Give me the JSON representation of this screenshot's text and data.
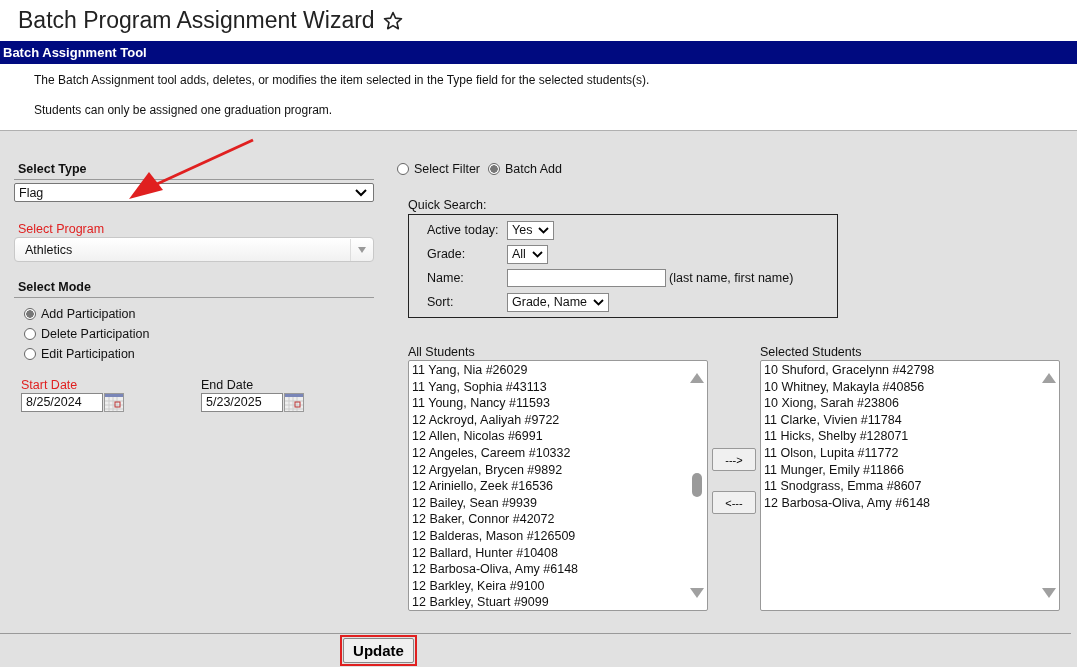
{
  "page_title": "Batch Program Assignment Wizard",
  "favorite": {
    "starred": false
  },
  "header_bar": {
    "title": "Batch Assignment Tool"
  },
  "description": [
    "The Batch Assignment tool adds, deletes, or modifies the item selected in the Type field for the selected students(s).",
    "Students can only be assigned one graduation program."
  ],
  "select_type": {
    "label": "Select Type",
    "value": "Flag",
    "required": false
  },
  "select_program": {
    "label": "Select Program",
    "value": "Athletics",
    "required": true
  },
  "select_mode": {
    "label": "Select Mode",
    "options": [
      {
        "label": "Add Participation",
        "selected": true
      },
      {
        "label": "Delete Participation",
        "selected": false
      },
      {
        "label": "Edit Participation",
        "selected": false
      }
    ]
  },
  "dates": [
    {
      "label": "Start Date",
      "value": "8/25/2024",
      "required": true
    },
    {
      "label": "End Date",
      "value": "5/23/2025",
      "required": false
    }
  ],
  "source": {
    "options": [
      {
        "label": "Select Filter",
        "selected": false
      },
      {
        "label": "Batch Add",
        "selected": true
      }
    ]
  },
  "quick_search": {
    "title": "Quick Search:",
    "fields": [
      {
        "kind": "select",
        "label": "Active today:",
        "value": "Yes"
      },
      {
        "kind": "select",
        "label": "Grade:",
        "value": "All"
      },
      {
        "kind": "text",
        "label": "Name:",
        "hint": "(last name, first name)"
      },
      {
        "kind": "select",
        "label": "Sort:",
        "value": "Grade, Name"
      }
    ]
  },
  "all_students": {
    "label": "All Students",
    "items": [
      "11 Yang, Nia  #26029",
      "11 Yang, Sophia  #43113",
      "11 Young, Nancy  #11593",
      "12 Ackroyd, Aaliyah  #9722",
      "12 Allen, Nicolas  #6991",
      "12 Angeles, Careem  #10332",
      "12 Argyelan, Brycen  #9892",
      "12 Ariniello, Zeek  #16536",
      "12 Bailey, Sean  #9939",
      "12 Baker, Connor  #42072",
      "12 Balderas, Mason  #126509",
      "12 Ballard, Hunter  #10408",
      "12 Barbosa-Oliva, Amy  #6148",
      "12 Barkley, Keira  #9100",
      "12 Barkley, Stuart  #9099"
    ]
  },
  "move_buttons": [
    "--->",
    "<---"
  ],
  "selected_students": {
    "label": "Selected Students",
    "items": [
      "10 Shuford, Gracelynn  #42798",
      "10 Whitney, Makayla  #40856",
      "10 Xiong, Sarah  #23806",
      "11 Clarke, Vivien  #11784",
      "11 Hicks, Shelby  #128071",
      "11 Olson, Lupita  #11772",
      "11 Munger, Emily  #11866",
      "11 Snodgrass, Emma  #8607",
      "12 Barbosa-Oliva, Amy  #6148"
    ]
  },
  "update_button": {
    "label": "Update",
    "highlighted": true
  }
}
